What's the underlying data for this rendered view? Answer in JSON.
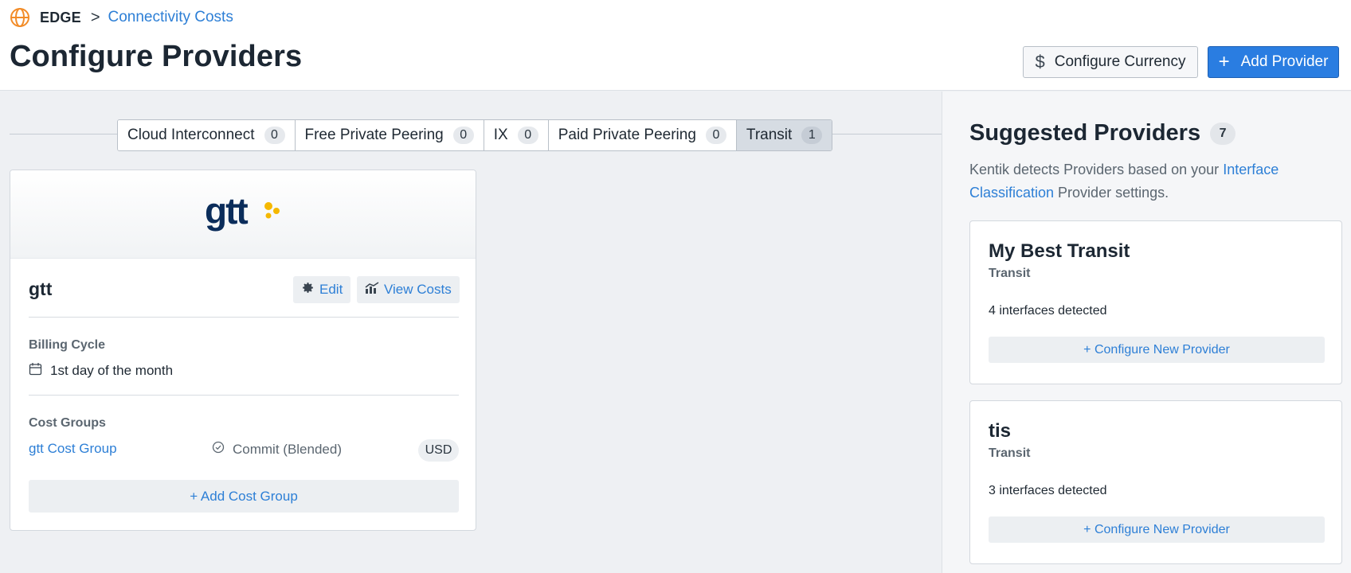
{
  "breadcrumb": {
    "section": "EDGE",
    "separator": ">",
    "current": "Connectivity Costs",
    "section_icon": "globe-icon"
  },
  "page": {
    "title": "Configure Providers"
  },
  "header_actions": {
    "configure_currency": {
      "icon": "dollar-icon",
      "icon_glyph": "$",
      "label": "Configure Currency"
    },
    "add_provider": {
      "icon": "plus-icon",
      "icon_glyph": "+",
      "label": "Add Provider"
    }
  },
  "tabs": [
    {
      "label": "Cloud Interconnect",
      "count": "0",
      "active": false
    },
    {
      "label": "Free Private Peering",
      "count": "0",
      "active": false
    },
    {
      "label": "IX",
      "count": "0",
      "active": false
    },
    {
      "label": "Paid Private Peering",
      "count": "0",
      "active": false
    },
    {
      "label": "Transit",
      "count": "1",
      "active": true
    }
  ],
  "provider_card": {
    "logo_text": "gtt",
    "name": "gtt",
    "edit_label": "Edit",
    "view_costs_label": "View Costs",
    "billing_cycle_label": "Billing Cycle",
    "billing_cycle_value": "1st day of the month",
    "cost_groups_label": "Cost Groups",
    "cost_group": {
      "name": "gtt Cost Group",
      "type": "Commit (Blended)",
      "currency": "USD"
    },
    "add_cost_group_label": "+ Add Cost Group"
  },
  "suggested": {
    "title": "Suggested Providers",
    "count": "7",
    "description_prefix": "Kentik detects Providers based on your ",
    "description_link": "Interface Classification",
    "description_suffix": " Provider settings.",
    "items": [
      {
        "name": "My Best Transit",
        "type": "Transit",
        "detected": "4 interfaces detected",
        "button": "+ Configure New Provider"
      },
      {
        "name": "tis",
        "type": "Transit",
        "detected": "3 interfaces detected",
        "button": "+ Configure New Provider"
      }
    ]
  },
  "colors": {
    "accent": "#2a7de1",
    "link": "#2d7fd6",
    "edge_icon": "#f28c28",
    "gtt_navy": "#0b2d5b",
    "gtt_yellow": "#f5b800"
  }
}
